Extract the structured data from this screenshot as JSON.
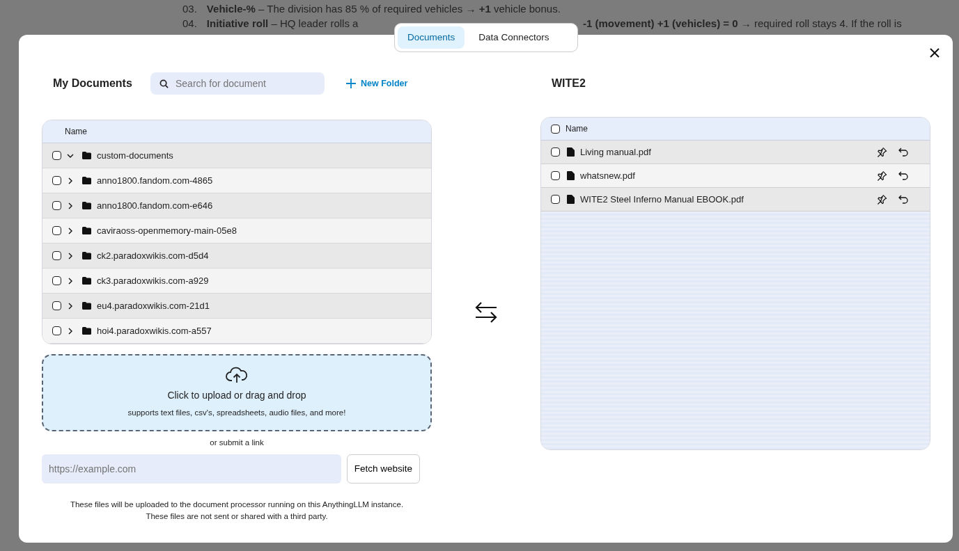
{
  "backdrop": {
    "lines": [
      {
        "number": "03.",
        "parts": [
          "**Vehicle-%** – The division has 85 % of required vehicles → **+1** vehicle bonus."
        ]
      },
      {
        "number": "04.",
        "parts": [
          "**Initiative roll** – HQ leader rolls a",
          "**-1 (movement) +1 (vehicles) = 0** → required roll stays 4. If the roll is"
        ]
      }
    ]
  },
  "tabs": [
    {
      "label": "Documents",
      "selected": true
    },
    {
      "label": "Data Connectors",
      "selected": false
    }
  ],
  "my_documents": {
    "title": "My Documents",
    "search": {
      "placeholder": "Search for document"
    },
    "new_folder": "New Folder",
    "table": {
      "column": "Name",
      "rows": [
        {
          "name": "custom-documents",
          "checked": false,
          "expanded": true
        },
        {
          "name": "anno1800.fandom.com-4865",
          "checked": false,
          "expanded": false
        },
        {
          "name": "anno1800.fandom.com-e646",
          "checked": false,
          "expanded": false
        },
        {
          "name": "caviraoss-openmemory-main-05e8",
          "checked": false,
          "expanded": false
        },
        {
          "name": "ck2.paradoxwikis.com-d5d4",
          "checked": false,
          "expanded": false
        },
        {
          "name": "ck3.paradoxwikis.com-a929",
          "checked": false,
          "expanded": false
        },
        {
          "name": "eu4.paradoxwikis.com-21d1",
          "checked": false,
          "expanded": false
        },
        {
          "name": "hoi4.paradoxwikis.com-a557",
          "checked": false,
          "expanded": false
        }
      ]
    },
    "upload": {
      "title": "Click to upload or drag and drop",
      "subtitle": "supports text files, csv's, spreadsheets, audio files, and more!"
    },
    "link_label": "or submit a link",
    "url": {
      "placeholder": "https://example.com"
    },
    "fetch_button": "Fetch website",
    "notice": [
      "These files will be uploaded to the document processor running on this AnythingLLM instance.",
      "These files are not sent or shared with a third party."
    ]
  },
  "workspace": {
    "title": "WITE2",
    "table": {
      "column": "Name",
      "checked": false,
      "rows": [
        {
          "name": "Living manual.pdf",
          "checked": false
        },
        {
          "name": "whatsnew.pdf",
          "checked": false
        },
        {
          "name": "WITE2 Steel Inferno Manual EBOOK.pdf",
          "checked": false
        }
      ]
    }
  }
}
